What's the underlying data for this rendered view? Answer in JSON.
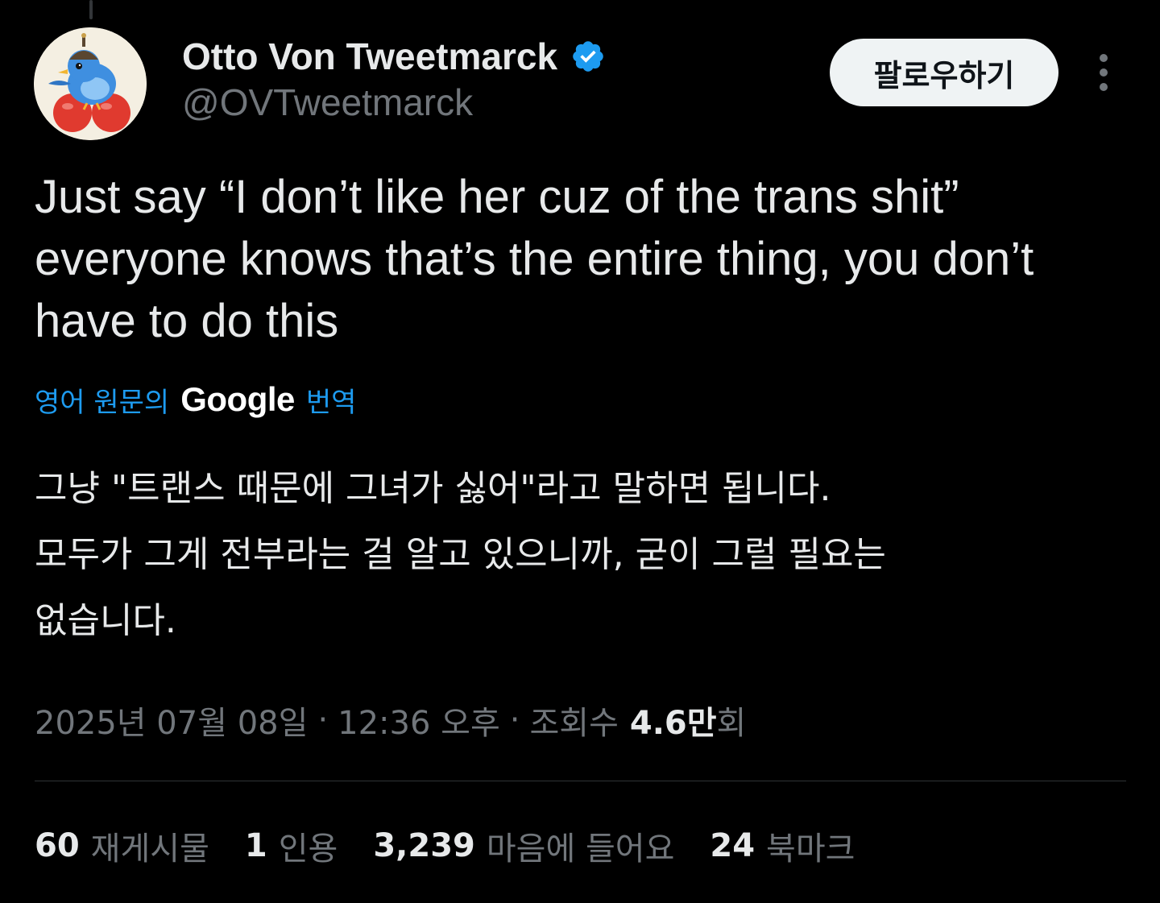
{
  "author": {
    "display_name": "Otto Von Tweetmarck",
    "handle": "@OVTweetmarck",
    "verified": true,
    "avatar_icon": "blue-bird-on-red-balls-avatar"
  },
  "actions": {
    "follow_label": "팔로우하기",
    "more_icon": "more-vertical-icon"
  },
  "tweet": {
    "lines": [
      "Just say “I don’t like her cuz of the trans shit”",
      "everyone knows that’s the entire thing, you don’t",
      "have to do this"
    ]
  },
  "translation": {
    "prefix": "영어 원문의",
    "brand": "Google",
    "suffix": "번역",
    "lines": [
      "그냥 \"트랜스 때문에 그녀가 싫어\"라고 말하면 됩니다.",
      "모두가 그게 전부라는 걸 알고 있으니까, 굳이 그럴 필요는",
      "없습니다."
    ]
  },
  "meta": {
    "date": "2025년 07월 08일",
    "separator": "·",
    "time": "12:36 오후",
    "views_label": "조회수",
    "views_count": "4.6만",
    "views_suffix": "회"
  },
  "stats": [
    {
      "count": "60",
      "label": "재게시물"
    },
    {
      "count": "1",
      "label": "인용"
    },
    {
      "count": "3,239",
      "label": "마음에 들어요"
    },
    {
      "count": "24",
      "label": "북마크"
    }
  ],
  "colors": {
    "background": "#000000",
    "text_primary": "#e7e9ea",
    "text_secondary": "#71767b",
    "link_blue": "#1d9bf0",
    "divider": "#2f3336",
    "follow_button_bg": "#eff3f4"
  }
}
